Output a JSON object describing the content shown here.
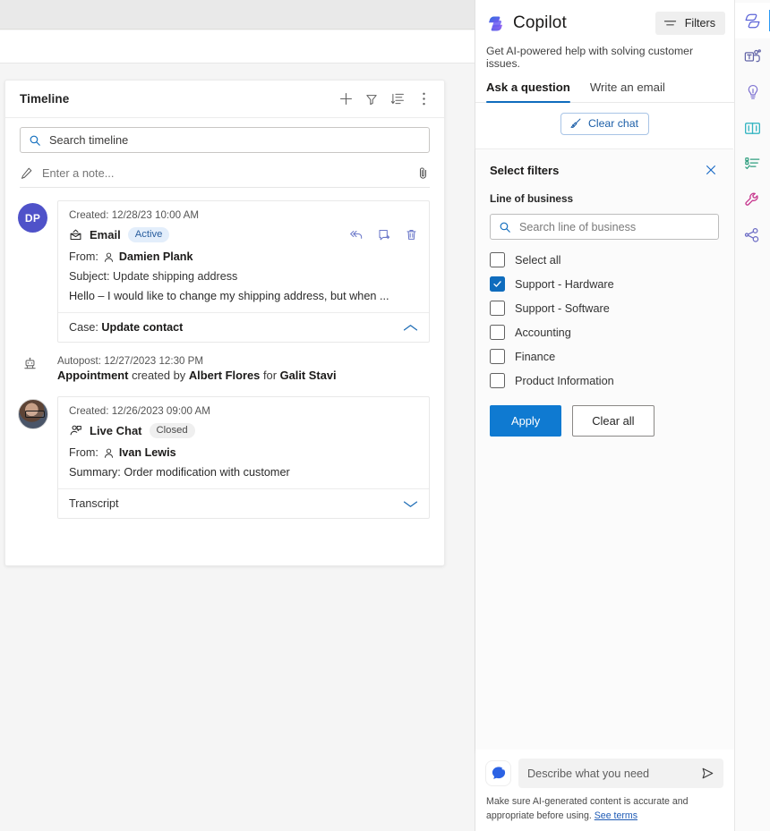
{
  "timeline": {
    "title": "Timeline",
    "header_icons": [
      "add-icon",
      "filter-icon",
      "sort-icon",
      "more-options-icon"
    ],
    "search_placeholder": "Search timeline",
    "note_placeholder": "Enter a note...",
    "entries": [
      {
        "avatar_initials": "DP",
        "meta": "Created: 12/28/23 10:00 AM",
        "type": "Email",
        "status": "Active",
        "from_label": "From:",
        "from_name": "Damien Plank",
        "subject": "Subject: Update shipping address",
        "preview": "Hello – I would like to change my shipping address, but when ...",
        "footer_label": "Case:",
        "footer_value": "Update contact"
      },
      {
        "meta": "Autopost: 12/27/2023 12:30 PM",
        "text_bold_1": "Appointment",
        "text_mid_1": " created by ",
        "text_bold_2": "Albert Flores",
        "text_mid_2": " for ",
        "text_bold_3": "Galit Stavi"
      },
      {
        "meta": "Created: 12/26/2023 09:00 AM",
        "type": "Live Chat",
        "status": "Closed",
        "from_label": "From:",
        "from_name": "Ivan Lewis",
        "summary": "Summary: Order modification with customer",
        "footer_label": "Transcript"
      }
    ]
  },
  "copilot": {
    "title": "Copilot",
    "subtitle": "Get AI-powered help with solving customer issues.",
    "filters_button": "Filters",
    "tabs": [
      {
        "label": "Ask a question",
        "selected": true
      },
      {
        "label": "Write an email",
        "selected": false
      }
    ],
    "clear_chat": "Clear chat",
    "composer_placeholder": "Describe what you need",
    "disclaimer_text": "Make sure AI-generated content is accurate and appropriate before using. ",
    "disclaimer_link": "See terms"
  },
  "filter_panel": {
    "title": "Select filters",
    "section_label": "Line of business",
    "search_placeholder": "Search line of business",
    "options": [
      {
        "label": "Select all",
        "checked": false
      },
      {
        "label": "Support - Hardware",
        "checked": true
      },
      {
        "label": "Support - Software",
        "checked": false
      },
      {
        "label": "Accounting",
        "checked": false
      },
      {
        "label": "Finance",
        "checked": false
      },
      {
        "label": "Product Information",
        "checked": false
      }
    ],
    "apply_label": "Apply",
    "clear_all_label": "Clear all"
  },
  "rail": {
    "items": [
      {
        "name": "copilot-rail-icon",
        "selected": true
      },
      {
        "name": "teams-rail-icon",
        "selected": false
      },
      {
        "name": "idea-lightbulb-rail-icon",
        "selected": false
      },
      {
        "name": "knowledge-book-rail-icon",
        "selected": false
      },
      {
        "name": "checklist-rail-icon",
        "selected": false
      },
      {
        "name": "wrench-tools-rail-icon",
        "selected": false
      },
      {
        "name": "relationship-graph-rail-icon",
        "selected": false
      }
    ]
  },
  "colors": {
    "accent": "#0f6cbd",
    "apply_blue": "#0f7ad1",
    "avatar_purple": "#4f52c9",
    "badge_active_bg": "#e3eefb",
    "badge_closed_bg": "#efefef"
  }
}
